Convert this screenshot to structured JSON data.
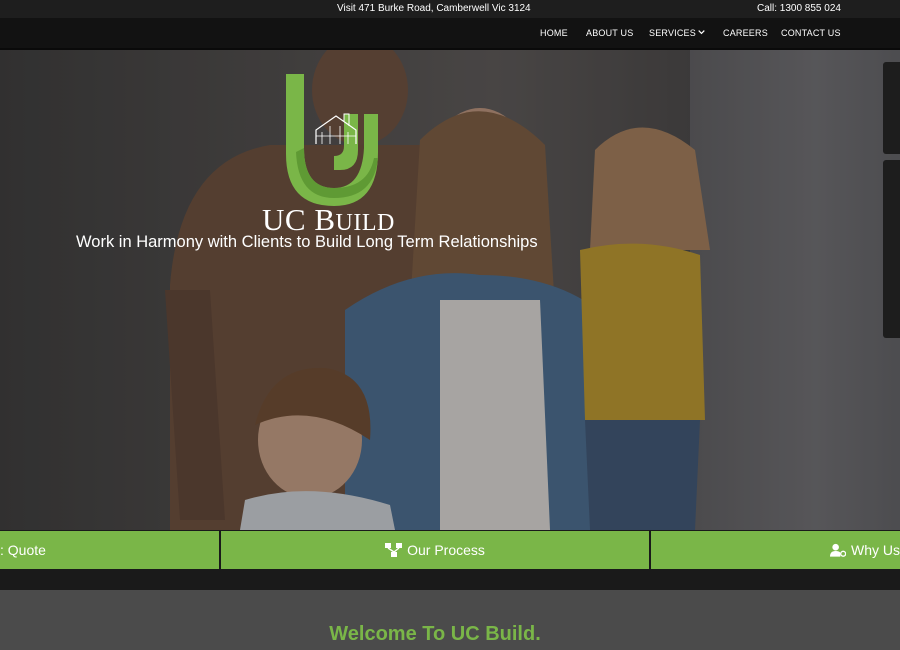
{
  "topbar": {
    "address": "Visit 471 Burke Road, Camberwell Vic 3124",
    "phone": "Call: 1300 855 024"
  },
  "nav": {
    "home": "HOME",
    "about": "ABOUT US",
    "services": "SERVICES",
    "careers": "CAREERS",
    "contact": "CONTACT US"
  },
  "hero": {
    "logo_text_big": "UC B",
    "logo_text_small": "UILD",
    "tagline": "Work in Harmony with Clients to Build Long Term Relationships"
  },
  "cta": {
    "quote": ": Quote",
    "process": "Our Process",
    "why_us": "Why Us"
  },
  "welcome": {
    "heading": "Welcome To UC Build."
  },
  "colors": {
    "brand_green": "#7ab648",
    "top_bar": "#1e1e1e",
    "nav_bar": "#121212"
  },
  "icons": {
    "process": "sitemap-icon",
    "why_us": "user-cog-icon",
    "services_dropdown": "chevron-down-icon"
  }
}
